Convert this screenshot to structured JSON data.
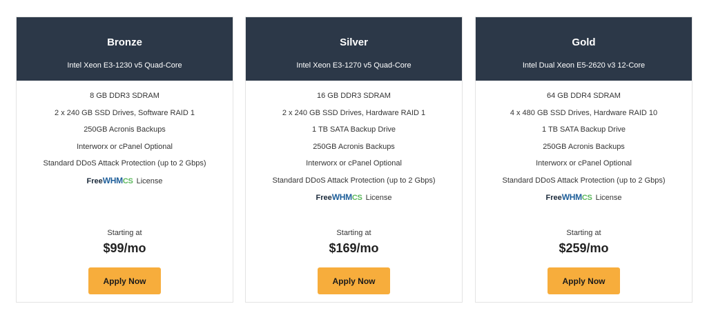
{
  "plans": [
    {
      "name": "Bronze",
      "cpu": "Intel Xeon E3-1230 v5 Quad-Core",
      "features": [
        "8 GB DDR3 SDRAM",
        "2 x 240 GB SSD Drives, Software RAID 1",
        "250GB Acronis Backups",
        "Interworx or cPanel Optional",
        "Standard DDoS Attack Protection (up to 2 Gbps)"
      ],
      "whmcs": {
        "free": "Free",
        "logo": "WHMCS",
        "license": "License"
      },
      "starting_label": "Starting at",
      "price": "$99/mo",
      "button_label": "Apply Now"
    },
    {
      "name": "Silver",
      "cpu": "Intel Xeon E3-1270 v5 Quad-Core",
      "features": [
        "16 GB DDR3 SDRAM",
        "2 x 240 GB SSD Drives, Hardware RAID 1",
        "1 TB SATA Backup Drive",
        "250GB Acronis Backups",
        "Interworx or cPanel Optional",
        "Standard DDoS Attack Protection (up to 2 Gbps)"
      ],
      "whmcs": {
        "free": "Free",
        "logo": "WHMCS",
        "license": "License"
      },
      "starting_label": "Starting at",
      "price": "$169/mo",
      "button_label": "Apply Now"
    },
    {
      "name": "Gold",
      "cpu": "Intel Dual Xeon E5-2620 v3 12-Core",
      "features": [
        "64 GB DDR4 SDRAM",
        "4 x 480 GB SSD Drives, Hardware RAID 10",
        "1 TB SATA Backup Drive",
        "250GB Acronis Backups",
        "Interworx or cPanel Optional",
        "Standard DDoS Attack Protection (up to 2 Gbps)"
      ],
      "whmcs": {
        "free": "Free",
        "logo": "WHMCS",
        "license": "License"
      },
      "starting_label": "Starting at",
      "price": "$259/mo",
      "button_label": "Apply Now"
    }
  ],
  "colors": {
    "header_bg": "#2c3848",
    "button_bg": "#f7ad3c",
    "whmcs_blue": "#1f5f9a",
    "whmcs_green": "#5cb85c"
  }
}
